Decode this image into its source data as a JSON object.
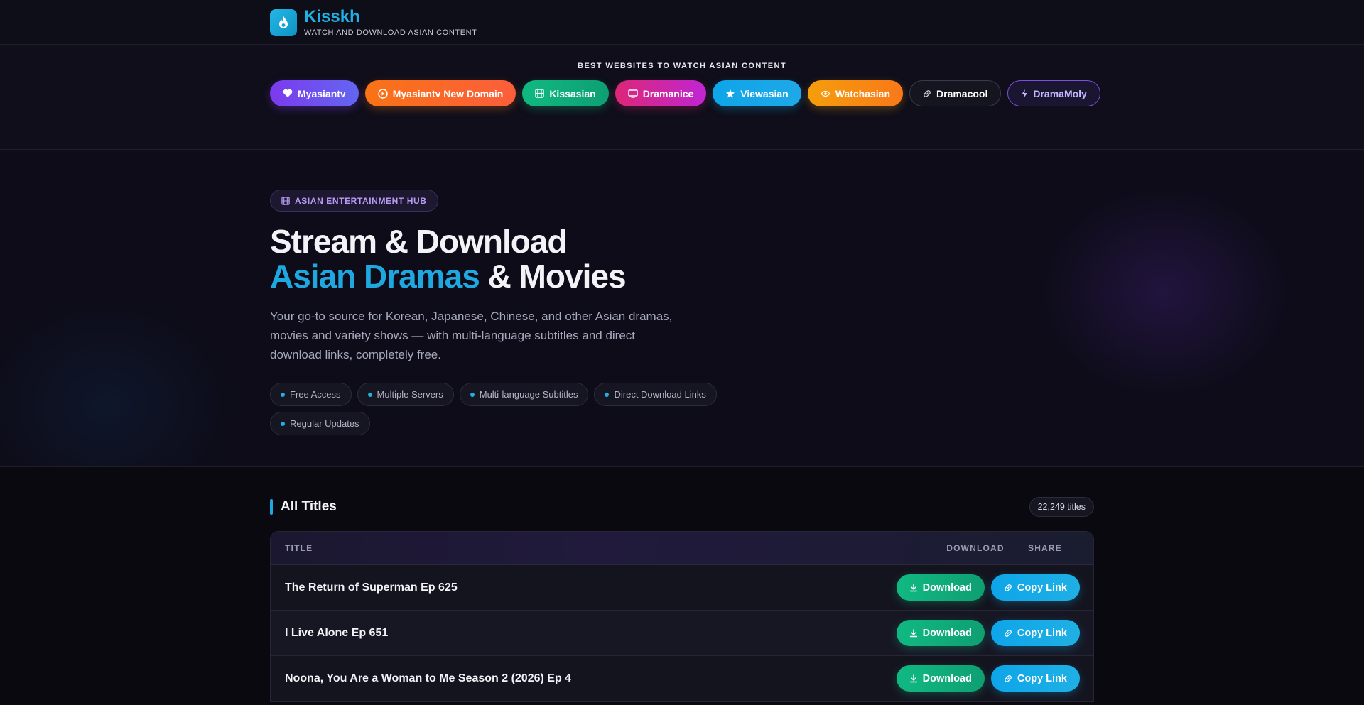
{
  "brand": {
    "name": "Kisskh",
    "tagline": "WATCH AND DOWNLOAD ASIAN CONTENT",
    "logo_icon": "flame-icon",
    "accent": "#1fb0e4"
  },
  "sites": {
    "title": "BEST WEBSITES TO WATCH ASIAN CONTENT",
    "items": [
      {
        "label": "Myasiantv",
        "icon": "heart-icon",
        "color": "#7c3aed"
      },
      {
        "label": "Myasiantv New Domain",
        "icon": "play-circle-icon",
        "color": "#f97316"
      },
      {
        "label": "Kissasian",
        "icon": "film-icon",
        "color": "#10b981"
      },
      {
        "label": "Dramanice",
        "icon": "monitor-icon",
        "color": "#db2777"
      },
      {
        "label": "Viewasian",
        "icon": "star-icon",
        "color": "#0ea5e9"
      },
      {
        "label": "Watchasian",
        "icon": "eye-icon",
        "color": "#f59e0b"
      },
      {
        "label": "Dramacool",
        "icon": "link-icon",
        "color": "#15151f"
      },
      {
        "label": "DramaMoly",
        "icon": "bolt-icon",
        "color": "#7c4fe0"
      }
    ]
  },
  "hero": {
    "badge": "ASIAN ENTERTAINMENT HUB",
    "badge_icon": "film-icon",
    "heading_line1": "Stream & Download",
    "heading_accent": "Asian Dramas",
    "heading_rest": " & Movies",
    "lead": "Your go-to source for Korean, Japanese, Chinese, and other Asian dramas, movies and variety shows — with multi-language subtitles and direct download links, completely free.",
    "features": [
      "Free Access",
      "Multiple Servers",
      "Multi-language Subtitles",
      "Direct Download Links",
      "Regular Updates"
    ]
  },
  "titles": {
    "heading": "All Titles",
    "count": "22,249 titles",
    "columns": {
      "title": "TITLE",
      "download": "DOWNLOAD",
      "share": "SHARE"
    },
    "download_label": "Download",
    "copy_label": "Copy Link",
    "rows": [
      {
        "title": "The Return of Superman Ep 625"
      },
      {
        "title": "I Live Alone Ep 651"
      },
      {
        "title": "Noona, You Are a Woman to Me Season 2 (2026) Ep 4"
      }
    ]
  }
}
